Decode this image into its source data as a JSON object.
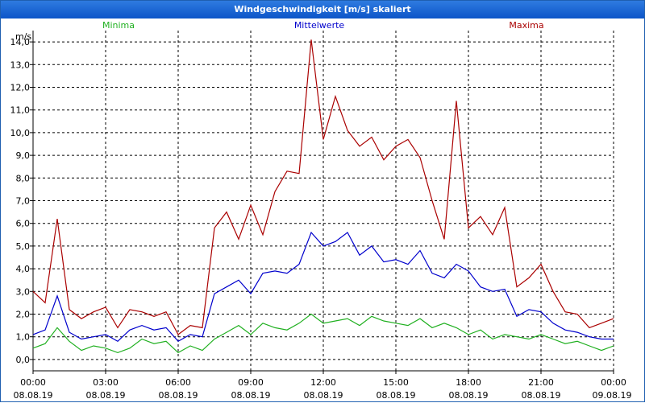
{
  "window": {
    "title": "Windgeschwindigkeit [m/s] skaliert"
  },
  "colors": {
    "min": "#20b020",
    "mean": "#0000cc",
    "max": "#aa0000",
    "grid": "#000000",
    "titlebar": "#0c55c8"
  },
  "chart_data": {
    "type": "line",
    "title": "Windgeschwindigkeit [m/s] skaliert",
    "ylabel": "m/s",
    "xlabel": "",
    "ylim": [
      -0.5,
      14.5
    ],
    "xlim": [
      "2019-08-08 00:00",
      "2019-08-09 00:00"
    ],
    "grid": true,
    "legend_position": "top",
    "y_ticks": [
      "0,0",
      "1,0",
      "2,0",
      "3,0",
      "4,0",
      "5,0",
      "6,0",
      "7,0",
      "8,0",
      "9,0",
      "10,0",
      "11,0",
      "12,0",
      "13,0",
      "14,0"
    ],
    "x_ticks": [
      {
        "time": "00:00",
        "date": "08.08.19"
      },
      {
        "time": "03:00",
        "date": "08.08.19"
      },
      {
        "time": "06:00",
        "date": "08.08.19"
      },
      {
        "time": "09:00",
        "date": "08.08.19"
      },
      {
        "time": "12:00",
        "date": "08.08.19"
      },
      {
        "time": "15:00",
        "date": "08.08.19"
      },
      {
        "time": "18:00",
        "date": "08.08.19"
      },
      {
        "time": "21:00",
        "date": "08.08.19"
      },
      {
        "time": "00:00",
        "date": "09.08.19"
      }
    ],
    "x": [
      "00:00",
      "00:30",
      "01:00",
      "01:30",
      "02:00",
      "02:30",
      "03:00",
      "03:30",
      "04:00",
      "04:30",
      "05:00",
      "05:30",
      "06:00",
      "06:30",
      "07:00",
      "07:30",
      "08:00",
      "08:30",
      "09:00",
      "09:30",
      "10:00",
      "10:30",
      "11:00",
      "11:30",
      "12:00",
      "12:30",
      "13:00",
      "13:30",
      "14:00",
      "14:30",
      "15:00",
      "15:30",
      "16:00",
      "16:30",
      "17:00",
      "17:30",
      "18:00",
      "18:30",
      "19:00",
      "19:30",
      "20:00",
      "20:30",
      "21:00",
      "21:30",
      "22:00",
      "22:30",
      "23:00",
      "23:30",
      "00:00"
    ],
    "series": [
      {
        "name": "Minima",
        "color": "#20b020",
        "values": [
          0.5,
          0.7,
          1.4,
          0.8,
          0.4,
          0.6,
          0.5,
          0.3,
          0.5,
          0.9,
          0.7,
          0.8,
          0.3,
          0.6,
          0.4,
          0.9,
          1.2,
          1.5,
          1.1,
          1.6,
          1.4,
          1.3,
          1.6,
          2.0,
          1.6,
          1.7,
          1.8,
          1.5,
          1.9,
          1.7,
          1.6,
          1.5,
          1.8,
          1.4,
          1.6,
          1.4,
          1.1,
          1.3,
          0.9,
          1.1,
          1.0,
          0.9,
          1.1,
          0.9,
          0.7,
          0.8,
          0.6,
          0.4,
          0.6
        ]
      },
      {
        "name": "Mittelwerte",
        "color": "#0000cc",
        "values": [
          1.1,
          1.3,
          2.8,
          1.2,
          0.9,
          1.0,
          1.1,
          0.8,
          1.3,
          1.5,
          1.3,
          1.4,
          0.8,
          1.1,
          1.0,
          2.9,
          3.2,
          3.5,
          2.9,
          3.8,
          3.9,
          3.8,
          4.2,
          5.6,
          5.0,
          5.2,
          5.6,
          4.6,
          5.0,
          4.3,
          4.4,
          4.2,
          4.8,
          3.8,
          3.6,
          4.2,
          3.9,
          3.2,
          3.0,
          3.1,
          1.9,
          2.2,
          2.1,
          1.6,
          1.3,
          1.2,
          1.0,
          0.9,
          0.9
        ]
      },
      {
        "name": "Maxima",
        "color": "#aa0000",
        "values": [
          3.0,
          2.5,
          6.2,
          2.2,
          1.8,
          2.1,
          2.3,
          1.4,
          2.2,
          2.1,
          1.9,
          2.1,
          1.1,
          1.5,
          1.4,
          5.8,
          6.5,
          5.3,
          6.8,
          5.5,
          7.4,
          8.3,
          8.2,
          14.1,
          9.7,
          11.6,
          10.1,
          9.4,
          9.8,
          8.8,
          9.4,
          9.7,
          8.9,
          7.0,
          5.3,
          11.4,
          5.8,
          6.3,
          5.5,
          6.7,
          3.2,
          3.6,
          4.2,
          3.0,
          2.1,
          2.0,
          1.4,
          1.6,
          1.8
        ]
      }
    ]
  }
}
